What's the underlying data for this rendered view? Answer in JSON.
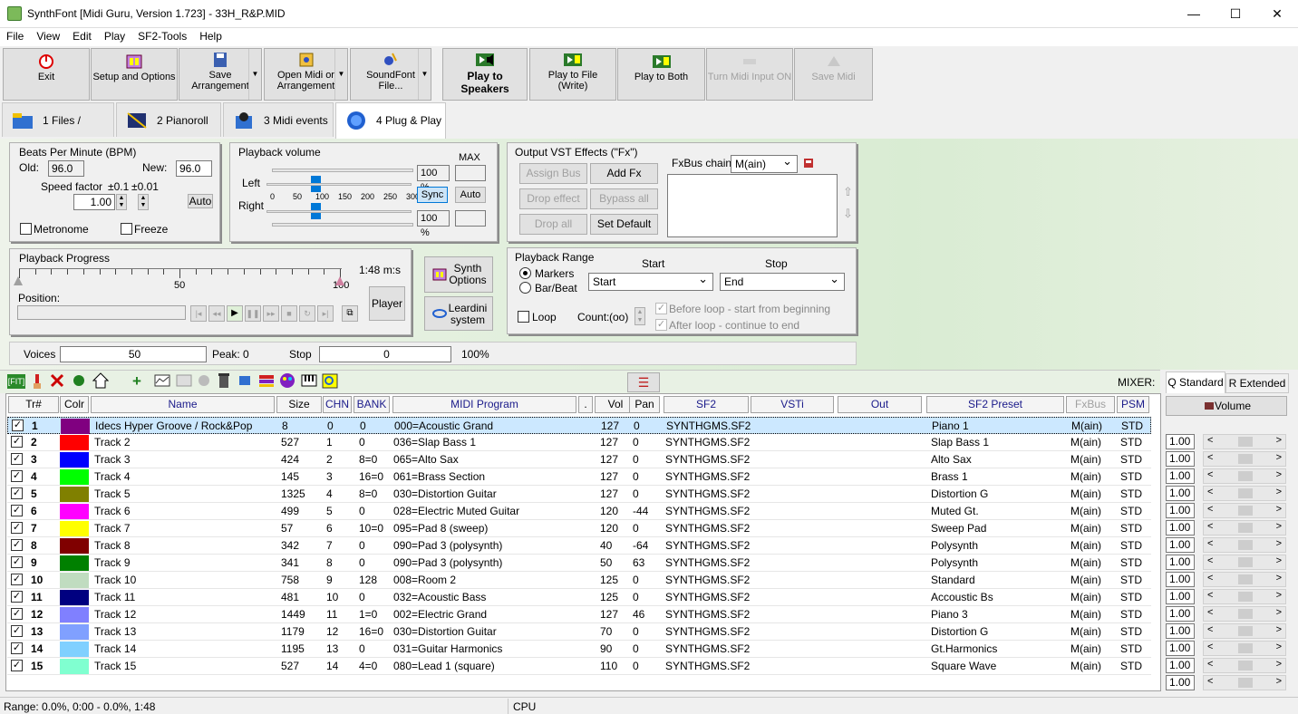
{
  "window": {
    "title": "SynthFont [Midi Guru, Version 1.723] - 33H_R&P.MID",
    "minimize": "—",
    "maximize": "☐",
    "close": "✕"
  },
  "menu": [
    "File",
    "View",
    "Edit",
    "Play",
    "SF2-Tools",
    "Help"
  ],
  "toolbar": {
    "exit": "Exit",
    "setup": "Setup and Options",
    "save_l1": "Save",
    "save_l2": "Arrangement",
    "open_l1": "Open Midi or",
    "open_l2": "Arrangement",
    "soundfont_l1": "SoundFont",
    "soundfont_l2": "File...",
    "play_speakers_l1": "Play to",
    "play_speakers_l2": "Speakers",
    "play_file_l1": "Play to File",
    "play_file_l2": "(Write)",
    "play_both": "Play to Both",
    "turn_midi": "Turn Midi Input ON",
    "save_midi": "Save Midi",
    "dropdown_glyph": "▼"
  },
  "tabs": [
    "1 Files / Folders",
    "2 Pianoroll",
    "3 Midi events",
    "4 Plug & Play"
  ],
  "bpm": {
    "title": "Beats Per Minute (BPM)",
    "old_label": "Old:",
    "old_value": "96.0",
    "new_label": "New:",
    "new_value": "96.0",
    "speed_label": "Speed factor",
    "step1": "±0.1",
    "step2": "±0.01",
    "speed_value": "1.00",
    "auto": "Auto",
    "metronome": "Metronome",
    "freeze": "Freeze"
  },
  "volume": {
    "title": "Playback volume",
    "max": "MAX",
    "left": "Left",
    "right": "Right",
    "left_pct": "100 %",
    "right_pct": "100 %",
    "scale": [
      "0",
      "50",
      "100",
      "150",
      "200",
      "250",
      "300"
    ],
    "sync": "Sync",
    "auto": "Auto",
    "left_level": 1.0,
    "right_level": 1.0
  },
  "vst": {
    "title": "Output VST Effects (\"Fx\")",
    "assign_bus": "Assign Bus",
    "add_fx": "Add Fx",
    "drop_effect": "Drop effect",
    "bypass_all": "Bypass all",
    "drop_all": "Drop all",
    "set_default": "Set Default",
    "chain_label": "FxBus chain",
    "chain_value": "M(ain)"
  },
  "progress": {
    "title": "Playback Progress",
    "time": "1:48 m:s",
    "mark_50": "50",
    "mark_100": "100",
    "position": "Position:",
    "player": "Player"
  },
  "side_buttons": {
    "synth_l1": "Synth",
    "synth_l2": "Options",
    "leardini_l1": "Leardini",
    "leardini_l2": "system"
  },
  "range": {
    "title": "Playback Range",
    "start_label": "Start",
    "stop_label": "Stop",
    "markers": "Markers",
    "barbeat": "Bar/Beat",
    "start_value": "Start",
    "stop_value": "End",
    "loop": "Loop",
    "count_label": "Count:",
    "count_value": "(oo)",
    "before_loop": "Before loop - start from beginning",
    "after_loop": "After loop - continue to end"
  },
  "voices": {
    "label": "Voices",
    "value": "50",
    "peak": "Peak: 0",
    "stop_label": "Stop",
    "stop_value": "0",
    "pct": "100%"
  },
  "mixer": {
    "label": "MIXER:",
    "tab_q": "Q Standard",
    "tab_r": "R Extended",
    "volume_button": "Volume"
  },
  "columns": [
    "Tr#",
    "Colr",
    "Name",
    "Size",
    "CHN",
    "BANK",
    "MIDI Program",
    ".",
    "Vol",
    "Pan",
    "SF2",
    "VSTi",
    "Out",
    "SF2 Preset",
    "FxBus",
    "PSM"
  ],
  "tracks": [
    {
      "n": "1",
      "color": "#800080",
      "name": "Idecs Hyper Groove / Rock&Pop",
      "size": "8",
      "chn": "0",
      "bank": "0",
      "prog": "000=Acoustic Grand",
      "vol": "127",
      "pan": "0",
      "sf2": "SYNTHGMS.SF2",
      "preset": "Piano 1",
      "fxbus": "M(ain)",
      "psm": "STD",
      "mvol": "1.00"
    },
    {
      "n": "2",
      "color": "#ff0000",
      "name": "Track 2",
      "size": "527",
      "chn": "1",
      "bank": "0",
      "prog": "036=Slap Bass 1",
      "vol": "127",
      "pan": "0",
      "sf2": "SYNTHGMS.SF2",
      "preset": "Slap Bass 1",
      "fxbus": "M(ain)",
      "psm": "STD",
      "mvol": "1.00"
    },
    {
      "n": "3",
      "color": "#0000ff",
      "name": "Track 3",
      "size": "424",
      "chn": "2",
      "bank": "8=0",
      "prog": "065=Alto Sax",
      "vol": "127",
      "pan": "0",
      "sf2": "SYNTHGMS.SF2",
      "preset": "Alto Sax",
      "fxbus": "M(ain)",
      "psm": "STD",
      "mvol": "1.00"
    },
    {
      "n": "4",
      "color": "#00ff00",
      "name": "Track 4",
      "size": "145",
      "chn": "3",
      "bank": "16=0",
      "prog": "061=Brass Section",
      "vol": "127",
      "pan": "0",
      "sf2": "SYNTHGMS.SF2",
      "preset": "Brass 1",
      "fxbus": "M(ain)",
      "psm": "STD",
      "mvol": "1.00"
    },
    {
      "n": "5",
      "color": "#808000",
      "name": "Track 5",
      "size": "1325",
      "chn": "4",
      "bank": "8=0",
      "prog": "030=Distortion Guitar",
      "vol": "127",
      "pan": "0",
      "sf2": "SYNTHGMS.SF2",
      "preset": "Distortion G",
      "fxbus": "M(ain)",
      "psm": "STD",
      "mvol": "1.00"
    },
    {
      "n": "6",
      "color": "#ff00ff",
      "name": "Track 6",
      "size": "499",
      "chn": "5",
      "bank": "0",
      "prog": "028=Electric Muted Guitar",
      "vol": "120",
      "pan": "-44",
      "sf2": "SYNTHGMS.SF2",
      "preset": "Muted Gt.",
      "fxbus": "M(ain)",
      "psm": "STD",
      "mvol": "1.00"
    },
    {
      "n": "7",
      "color": "#ffff00",
      "name": "Track 7",
      "size": "57",
      "chn": "6",
      "bank": "10=0",
      "prog": "095=Pad 8 (sweep)",
      "vol": "120",
      "pan": "0",
      "sf2": "SYNTHGMS.SF2",
      "preset": "Sweep Pad",
      "fxbus": "M(ain)",
      "psm": "STD",
      "mvol": "1.00"
    },
    {
      "n": "8",
      "color": "#800000",
      "name": "Track 8",
      "size": "342",
      "chn": "7",
      "bank": "0",
      "prog": "090=Pad 3 (polysynth)",
      "vol": "40",
      "pan": "-64",
      "sf2": "SYNTHGMS.SF2",
      "preset": "Polysynth",
      "fxbus": "M(ain)",
      "psm": "STD",
      "mvol": "1.00"
    },
    {
      "n": "9",
      "color": "#008000",
      "name": "Track 9",
      "size": "341",
      "chn": "8",
      "bank": "0",
      "prog": "090=Pad 3 (polysynth)",
      "vol": "50",
      "pan": "63",
      "sf2": "SYNTHGMS.SF2",
      "preset": "Polysynth",
      "fxbus": "M(ain)",
      "psm": "STD",
      "mvol": "1.00"
    },
    {
      "n": "10",
      "color": "#c0dcc0",
      "name": "Track 10",
      "size": "758",
      "chn": "9",
      "bank": "128",
      "prog": "008=Room 2",
      "vol": "125",
      "pan": "0",
      "sf2": "SYNTHGMS.SF2",
      "preset": "Standard",
      "fxbus": "M(ain)",
      "psm": "STD",
      "mvol": "1.00"
    },
    {
      "n": "11",
      "color": "#000080",
      "name": "Track 11",
      "size": "481",
      "chn": "10",
      "bank": "0",
      "prog": "032=Acoustic Bass",
      "vol": "125",
      "pan": "0",
      "sf2": "SYNTHGMS.SF2",
      "preset": "Accoustic Bs",
      "fxbus": "M(ain)",
      "psm": "STD",
      "mvol": "1.00"
    },
    {
      "n": "12",
      "color": "#8080ff",
      "name": "Track 12",
      "size": "1449",
      "chn": "11",
      "bank": "1=0",
      "prog": "002=Electric Grand",
      "vol": "127",
      "pan": "46",
      "sf2": "SYNTHGMS.SF2",
      "preset": "Piano 3",
      "fxbus": "M(ain)",
      "psm": "STD",
      "mvol": "1.00"
    },
    {
      "n": "13",
      "color": "#80a0ff",
      "name": "Track 13",
      "size": "1179",
      "chn": "12",
      "bank": "16=0",
      "prog": "030=Distortion Guitar",
      "vol": "70",
      "pan": "0",
      "sf2": "SYNTHGMS.SF2",
      "preset": "Distortion G",
      "fxbus": "M(ain)",
      "psm": "STD",
      "mvol": "1.00"
    },
    {
      "n": "14",
      "color": "#80d0ff",
      "name": "Track 14",
      "size": "1195",
      "chn": "13",
      "bank": "0",
      "prog": "031=Guitar Harmonics",
      "vol": "90",
      "pan": "0",
      "sf2": "SYNTHGMS.SF2",
      "preset": "Gt.Harmonics",
      "fxbus": "M(ain)",
      "psm": "STD",
      "mvol": "1.00"
    },
    {
      "n": "15",
      "color": "#80ffd0",
      "name": "Track 15",
      "size": "527",
      "chn": "14",
      "bank": "4=0",
      "prog": "080=Lead 1 (square)",
      "vol": "110",
      "pan": "0",
      "sf2": "SYNTHGMS.SF2",
      "preset": "Square Wave",
      "fxbus": "M(ain)",
      "psm": "STD",
      "mvol": "1.00"
    }
  ],
  "status": {
    "range": "Range: 0.0%, 0:00 - 0.0%, 1:48",
    "cpu": "CPU"
  }
}
